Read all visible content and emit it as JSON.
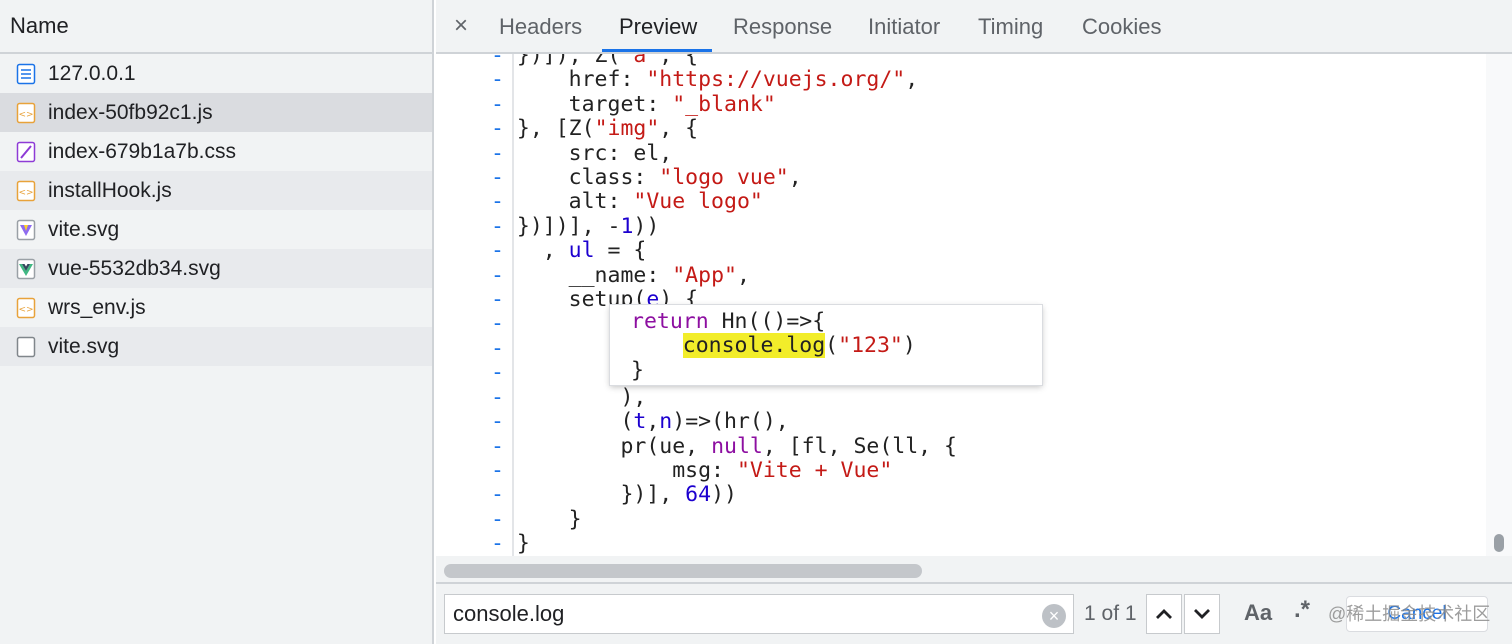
{
  "sidebar": {
    "header": "Name",
    "files": [
      {
        "name": "127.0.0.1",
        "icon": "document-icon"
      },
      {
        "name": "index-50fb92c1.js",
        "icon": "script-file-icon"
      },
      {
        "name": "index-679b1a7b.css",
        "icon": "stylesheet-file-icon"
      },
      {
        "name": "installHook.js",
        "icon": "script-file-icon"
      },
      {
        "name": "vite.svg",
        "icon": "vite-logo-icon"
      },
      {
        "name": "vue-5532db34.svg",
        "icon": "vue-logo-icon"
      },
      {
        "name": "wrs_env.js",
        "icon": "script-file-icon"
      },
      {
        "name": "vite.svg",
        "icon": "blank-file-icon"
      }
    ],
    "selected_index": 1
  },
  "tabs": {
    "close": "×",
    "items": [
      "Headers",
      "Preview",
      "Response",
      "Initiator",
      "Timing",
      "Cookies"
    ],
    "active": "Preview"
  },
  "code": {
    "lines": [
      "})]), Z(\"a\", {",
      "    href: \"https://vuejs.org/\",",
      "    target: \"_blank\"",
      "}, [Z(\"img\", {",
      "    src: el,",
      "    class: \"logo vue\",",
      "    alt: \"Vue logo\"",
      "})])], -1))",
      "  , ul = {",
      "    __name: \"App\",",
      "    setup(e) {",
      "",
      "",
      "",
      "        ),",
      "        (t,n)=>(hr(),",
      "        pr(ue, null, [fl, Se(ll, {",
      "            msg: \"Vite + Vue\"",
      "        })], 64))",
      "    }",
      "}"
    ],
    "popup_lines": [
      "return Hn(()=>{",
      "    console.log(\"123\")",
      "}"
    ]
  },
  "search": {
    "query": "console.log",
    "clear": "×",
    "match_count": "1 of 1",
    "case_label": "Aa",
    "regex_label": ".*",
    "cancel_label": "Cancel"
  },
  "watermark": "@稀土掘金技术社区",
  "colors": {
    "accent": "#1a73e8",
    "string": "#c41a16",
    "keyword": "#8d0fa1",
    "number": "#1c00cf",
    "highlight": "#f2ed2a"
  }
}
